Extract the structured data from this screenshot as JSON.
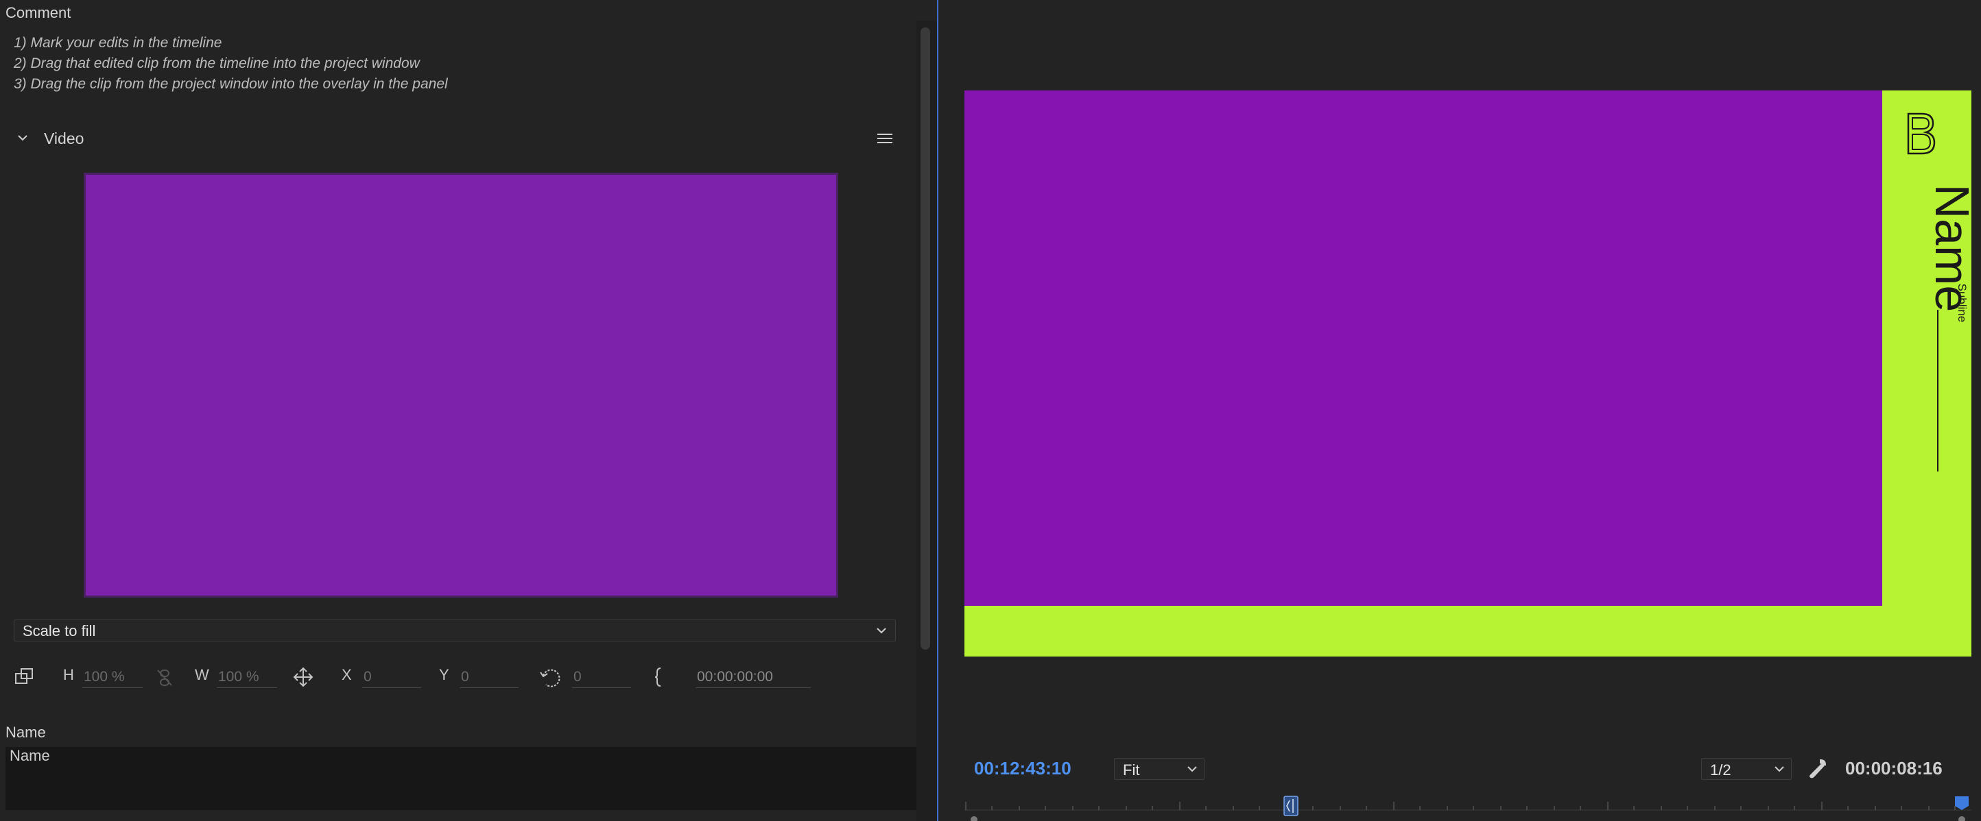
{
  "comment": {
    "label": "Comment",
    "lines": [
      "1) Mark your edits in the timeline",
      "2) Drag that edited clip from the timeline into the project window",
      "3) Drag the clip from the project window into the overlay in the panel"
    ]
  },
  "video_section": {
    "title": "Video",
    "thumbnail_color": "#7d22aa"
  },
  "scale": {
    "selected": "Scale to fill"
  },
  "transform": {
    "h_label": "H",
    "h_value": "100 %",
    "w_label": "W",
    "w_value": "100 %",
    "x_label": "X",
    "x_value": "0",
    "y_label": "Y",
    "y_value": "0",
    "rotation_value": "0",
    "timecode": "00:00:00:00"
  },
  "name_field": {
    "label": "Name",
    "value": "Name"
  },
  "program_monitor": {
    "overlay_name": "Name",
    "overlay_subline": "Subline",
    "background_color": "#8614b1",
    "accent_color": "#b7f233",
    "playhead_timecode": "00:12:43:10",
    "zoom": "Fit",
    "resolution": "1/2",
    "duration_timecode": "00:00:08:16"
  },
  "colors": {
    "accent_blue": "#3f6fd1",
    "timecode_blue": "#4e91f0"
  }
}
